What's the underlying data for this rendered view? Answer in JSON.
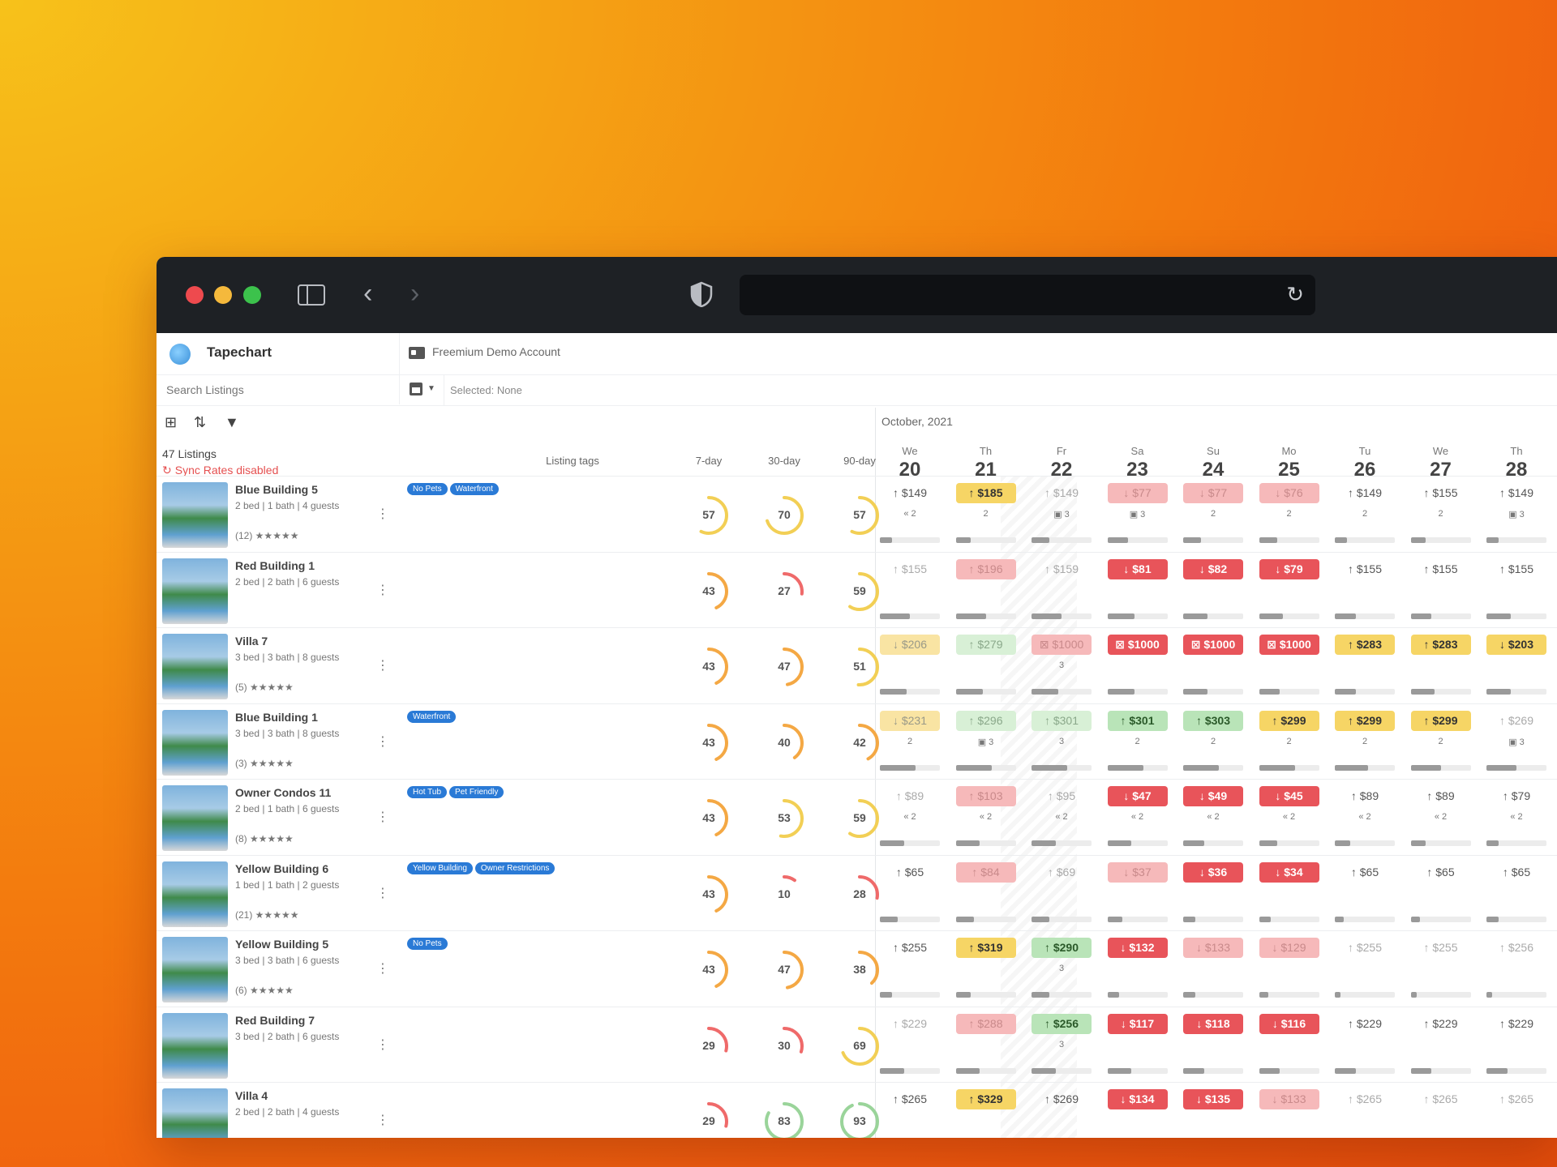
{
  "app": {
    "title": "Tapechart",
    "account": "Freemium Demo Account"
  },
  "search": {
    "placeholder": "Search Listings"
  },
  "selection": {
    "text": "Selected: None"
  },
  "summary": {
    "count": "47 Listings",
    "sync": "Sync Rates disabled"
  },
  "columns": {
    "tags": "Listing tags",
    "d7": "7-day",
    "d30": "30-day",
    "d90": "90-day"
  },
  "month": "October, 2021",
  "days": [
    {
      "dow": "We",
      "num": "20"
    },
    {
      "dow": "Th",
      "num": "21"
    },
    {
      "dow": "Fr",
      "num": "22"
    },
    {
      "dow": "Sa",
      "num": "23"
    },
    {
      "dow": "Su",
      "num": "24"
    },
    {
      "dow": "Mo",
      "num": "25"
    },
    {
      "dow": "Tu",
      "num": "26"
    },
    {
      "dow": "We",
      "num": "27"
    },
    {
      "dow": "Th",
      "num": "28"
    }
  ],
  "listings": [
    {
      "name": "Blue Building 5",
      "desc": "2 bed | 1 bath | 4 guests",
      "reviews": "(12) ★★★★★",
      "tags": [
        "No Pets",
        "Waterfront"
      ],
      "g": [
        57,
        70,
        57
      ],
      "prices": [
        [
          "$149",
          "plain",
          "↑"
        ],
        [
          "$185",
          "y",
          "↑"
        ],
        [
          "$149",
          "dim",
          "↑"
        ],
        [
          "$77",
          "rd",
          "↓"
        ],
        [
          "$77",
          "rd",
          "↓"
        ],
        [
          "$76",
          "rd",
          "↓"
        ],
        [
          "$149",
          "plain",
          "↑"
        ],
        [
          "$155",
          "plain",
          "↑"
        ],
        [
          "$149",
          "plain",
          "↑"
        ]
      ],
      "subs": [
        "« 2",
        "2",
        "▣ 3",
        "▣ 3",
        "2",
        "2",
        "2",
        "2",
        "▣ 3"
      ],
      "bars": [
        20,
        25,
        30,
        35,
        30,
        30,
        20,
        25,
        20
      ]
    },
    {
      "name": "Red Building 1",
      "desc": "2 bed | 2 bath | 6 guests",
      "reviews": "",
      "tags": [],
      "g": [
        43,
        27,
        59
      ],
      "prices": [
        [
          "$155",
          "dim",
          "↑"
        ],
        [
          "$196",
          "rd",
          "↑"
        ],
        [
          "$159",
          "dim",
          "↑"
        ],
        [
          "$81",
          "r",
          "↓"
        ],
        [
          "$82",
          "r",
          "↓"
        ],
        [
          "$79",
          "r",
          "↓"
        ],
        [
          "$155",
          "plain",
          "↑"
        ],
        [
          "$155",
          "plain",
          "↑"
        ],
        [
          "$155",
          "plain",
          "↑"
        ]
      ],
      "subs": [
        "",
        "",
        "",
        "",
        "",
        "",
        "",
        "",
        ""
      ],
      "bars": [
        50,
        50,
        50,
        45,
        40,
        40,
        35,
        35,
        40
      ]
    },
    {
      "name": "Villa 7",
      "desc": "3 bed | 3 bath | 8 guests",
      "reviews": "(5) ★★★★★",
      "tags": [],
      "g": [
        43,
        47,
        51
      ],
      "prices": [
        [
          "$206",
          "yd",
          "↓"
        ],
        [
          "$279",
          "gd",
          "↑"
        ],
        [
          "$1000",
          "rd",
          "⊠"
        ],
        [
          "$1000",
          "r",
          "⊠"
        ],
        [
          "$1000",
          "r",
          "⊠"
        ],
        [
          "$1000",
          "r",
          "⊠"
        ],
        [
          "$283",
          "y",
          "↑"
        ],
        [
          "$283",
          "y",
          "↑"
        ],
        [
          "$203",
          "y",
          "↓"
        ]
      ],
      "subs": [
        "",
        "",
        "3",
        "",
        "",
        "",
        "",
        "",
        ""
      ],
      "bars": [
        45,
        45,
        45,
        45,
        40,
        35,
        35,
        40,
        40
      ]
    },
    {
      "name": "Blue Building 1",
      "desc": "3 bed | 3 bath | 8 guests",
      "reviews": "(3) ★★★★★",
      "tags": [
        "Waterfront"
      ],
      "g": [
        43,
        40,
        42
      ],
      "prices": [
        [
          "$231",
          "yd",
          "↓"
        ],
        [
          "$296",
          "gd",
          "↑"
        ],
        [
          "$301",
          "gd",
          "↑"
        ],
        [
          "$301",
          "g",
          "↑"
        ],
        [
          "$303",
          "g",
          "↑"
        ],
        [
          "$299",
          "y",
          "↑"
        ],
        [
          "$299",
          "y",
          "↑"
        ],
        [
          "$299",
          "y",
          "↑"
        ],
        [
          "$269",
          "dim",
          "↑"
        ]
      ],
      "subs": [
        "2",
        "▣ 3",
        "3",
        "2",
        "2",
        "2",
        "2",
        "2",
        "▣ 3"
      ],
      "bars": [
        60,
        60,
        60,
        60,
        60,
        60,
        55,
        50,
        50
      ]
    },
    {
      "name": "Owner Condos 11",
      "desc": "2 bed | 1 bath | 6 guests",
      "reviews": "(8) ★★★★★",
      "tags": [
        "Hot Tub",
        "Pet Friendly"
      ],
      "g": [
        43,
        53,
        59
      ],
      "prices": [
        [
          "$89",
          "dim",
          "↑"
        ],
        [
          "$103",
          "rd",
          "↑"
        ],
        [
          "$95",
          "dim",
          "↑"
        ],
        [
          "$47",
          "r",
          "↓"
        ],
        [
          "$49",
          "r",
          "↓"
        ],
        [
          "$45",
          "r",
          "↓"
        ],
        [
          "$89",
          "plain",
          "↑"
        ],
        [
          "$89",
          "plain",
          "↑"
        ],
        [
          "$79",
          "plain",
          "↑"
        ]
      ],
      "subs": [
        "« 2",
        "« 2",
        "« 2",
        "« 2",
        "« 2",
        "« 2",
        "« 2",
        "« 2",
        "« 2"
      ],
      "bars": [
        40,
        40,
        40,
        40,
        35,
        30,
        25,
        25,
        20
      ]
    },
    {
      "name": "Yellow Building 6",
      "desc": "1 bed | 1 bath | 2 guests",
      "reviews": "(21) ★★★★★",
      "tags": [
        "Yellow Building",
        "Owner Restrictions"
      ],
      "g": [
        43,
        10,
        28
      ],
      "prices": [
        [
          "$65",
          "plain",
          "↑"
        ],
        [
          "$84",
          "rd",
          "↑"
        ],
        [
          "$69",
          "dim",
          "↑"
        ],
        [
          "$37",
          "rd",
          "↓"
        ],
        [
          "$36",
          "r",
          "↓"
        ],
        [
          "$34",
          "r",
          "↓"
        ],
        [
          "$65",
          "plain",
          "↑"
        ],
        [
          "$65",
          "plain",
          "↑"
        ],
        [
          "$65",
          "plain",
          "↑"
        ]
      ],
      "subs": [
        "",
        "",
        "",
        "",
        "",
        "",
        "",
        "",
        ""
      ],
      "bars": [
        30,
        30,
        30,
        25,
        20,
        20,
        15,
        15,
        20
      ]
    },
    {
      "name": "Yellow Building 5",
      "desc": "3 bed | 3 bath | 6 guests",
      "reviews": "(6) ★★★★★",
      "tags": [
        "No Pets"
      ],
      "g": [
        43,
        47,
        38
      ],
      "prices": [
        [
          "$255",
          "plain",
          "↑"
        ],
        [
          "$319",
          "y",
          "↑"
        ],
        [
          "$290",
          "g",
          "↑"
        ],
        [
          "$132",
          "r",
          "↓"
        ],
        [
          "$133",
          "rd",
          "↓"
        ],
        [
          "$129",
          "rd",
          "↓"
        ],
        [
          "$255",
          "dim",
          "↑"
        ],
        [
          "$255",
          "dim",
          "↑"
        ],
        [
          "$256",
          "dim",
          "↑"
        ]
      ],
      "subs": [
        "",
        "",
        "3",
        "",
        "",
        "",
        "",
        "",
        ""
      ],
      "bars": [
        20,
        25,
        30,
        20,
        20,
        15,
        10,
        10,
        10
      ]
    },
    {
      "name": "Red Building 7",
      "desc": "3 bed | 2 bath | 6 guests",
      "reviews": "",
      "tags": [],
      "g": [
        29,
        30,
        69
      ],
      "prices": [
        [
          "$229",
          "dim",
          "↑"
        ],
        [
          "$288",
          "rd",
          "↑"
        ],
        [
          "$256",
          "g",
          "↑"
        ],
        [
          "$117",
          "r",
          "↓"
        ],
        [
          "$118",
          "r",
          "↓"
        ],
        [
          "$116",
          "r",
          "↓"
        ],
        [
          "$229",
          "plain",
          "↑"
        ],
        [
          "$229",
          "plain",
          "↑"
        ],
        [
          "$229",
          "plain",
          "↑"
        ]
      ],
      "subs": [
        "",
        "",
        "3",
        "",
        "",
        "",
        "",
        "",
        ""
      ],
      "bars": [
        40,
        40,
        40,
        40,
        35,
        35,
        35,
        35,
        35
      ]
    },
    {
      "name": "Villa 4",
      "desc": "2 bed | 2 bath | 4 guests",
      "reviews": "",
      "tags": [],
      "g": [
        29,
        83,
        93
      ],
      "prices": [
        [
          "$265",
          "plain",
          "↑"
        ],
        [
          "$329",
          "y",
          "↑"
        ],
        [
          "$269",
          "plain",
          "↑"
        ],
        [
          "$134",
          "r",
          "↓"
        ],
        [
          "$135",
          "r",
          "↓"
        ],
        [
          "$133",
          "rd",
          "↓"
        ],
        [
          "$265",
          "dim",
          "↑"
        ],
        [
          "$265",
          "dim",
          "↑"
        ],
        [
          "$265",
          "dim",
          "↑"
        ]
      ],
      "subs": [
        "",
        "",
        "",
        "",
        "",
        "",
        "",
        "",
        ""
      ],
      "bars": [
        0,
        0,
        0,
        0,
        0,
        0,
        0,
        0,
        0
      ]
    }
  ]
}
